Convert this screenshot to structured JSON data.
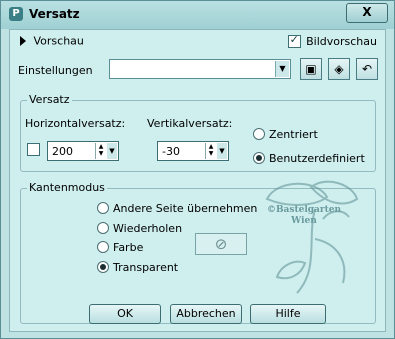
{
  "window": {
    "title": "Versatz",
    "close_label": "X"
  },
  "preview": {
    "label": "Vorschau",
    "bild_label": "Bildvorschau",
    "bild_checked": true
  },
  "settings": {
    "label": "Einstellungen",
    "value": ""
  },
  "versatz": {
    "legend": "Versatz",
    "horizontal_label": "Horizontalversatz:",
    "vertical_label": "Vertikalversatz:",
    "horizontal_value": "200",
    "vertical_value": "-30",
    "centered_label": "Zentriert",
    "custom_label": "Benutzerdefiniert",
    "selected": "Benutzerdefiniert"
  },
  "kantenmodus": {
    "legend": "Kantenmodus",
    "options": [
      "Andere Seite übernehmen",
      "Wiederholen",
      "Farbe",
      "Transparent"
    ],
    "selected": "Transparent"
  },
  "watermark": {
    "line1": "©Bastelgarten",
    "line2": "Wien"
  },
  "buttons": {
    "ok": "OK",
    "cancel": "Abbrechen",
    "help": "Hilfe"
  }
}
